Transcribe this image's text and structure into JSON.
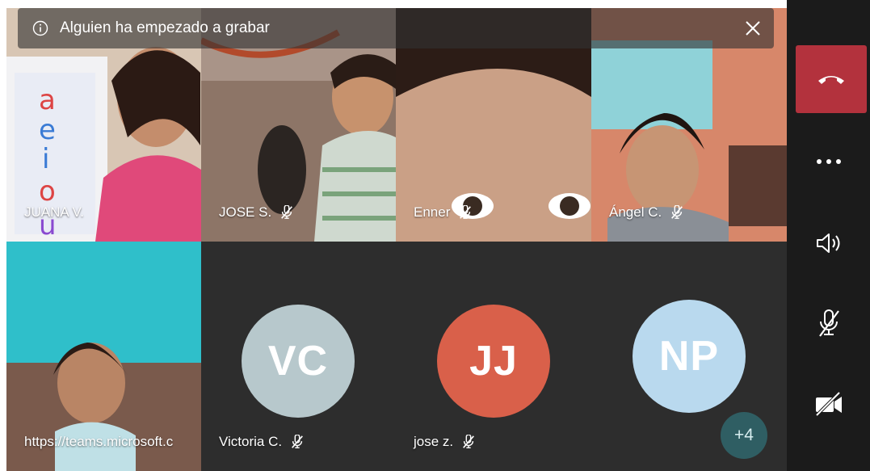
{
  "banner": {
    "text": "Alguien ha empezado a grabar"
  },
  "participants": [
    {
      "name": "JUANA V."
    },
    {
      "name": "JOSE S."
    },
    {
      "name": "Enner"
    },
    {
      "name": "Ángel C."
    },
    {
      "name": "https://teams.microsoft.c"
    },
    {
      "name": "Victoria C.",
      "initials": "VC",
      "color": "#b7c8cc"
    },
    {
      "name": "jose z.",
      "initials": "JJ",
      "color": "#d9604a"
    },
    {
      "name": "",
      "initials": "NP",
      "color": "#b9d9ee"
    }
  ],
  "overflow": {
    "label": "+4"
  },
  "controls": [
    "hang-up",
    "more-options",
    "speaker",
    "mute-microphone",
    "camera-off"
  ],
  "colors": {
    "hangup": "#b3323d",
    "rail": "#1b1b1b",
    "tile": "#2d2d2d"
  }
}
